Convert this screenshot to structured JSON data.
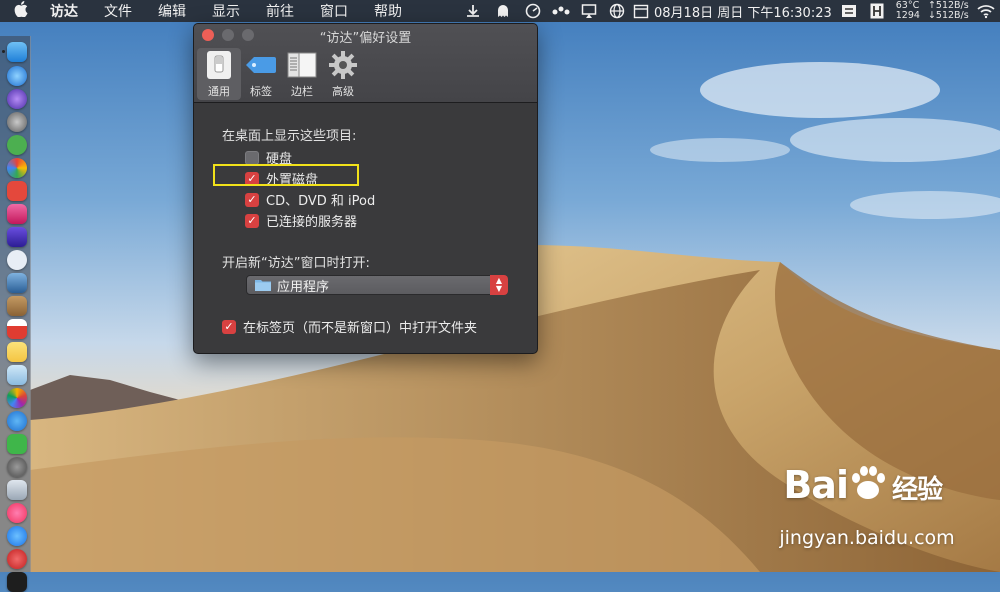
{
  "menubar": {
    "apple_icon": "apple-logo",
    "items": [
      "访达",
      "文件",
      "编辑",
      "显示",
      "前往",
      "窗口",
      "帮助"
    ],
    "clock": "08月18日 周日 下午16:30:23",
    "temperature": "63°C",
    "fan_rpm": "1294",
    "net_up": "↑512B/s",
    "net_down": "↓512B/s"
  },
  "window": {
    "title": "“访达”偏好设置",
    "toolbar": [
      {
        "label": "通用",
        "icon": "switch-icon",
        "active": true
      },
      {
        "label": "标签",
        "icon": "tag-icon",
        "active": false
      },
      {
        "label": "边栏",
        "icon": "sidebar-icon",
        "active": false
      },
      {
        "label": "高级",
        "icon": "gear-icon",
        "active": false
      }
    ],
    "desktop_section_label": "在桌面上显示这些项目:",
    "checkboxes": [
      {
        "label": "硬盘",
        "checked": false
      },
      {
        "label": "外置磁盘",
        "checked": true
      },
      {
        "label": "CD、DVD 和 iPod",
        "checked": true
      },
      {
        "label": "已连接的服务器",
        "checked": true
      }
    ],
    "new_window_label": "开启新“访达”窗口时打开:",
    "new_window_value": "应用程序",
    "open_in_tabs_label": "在标签页（而不是新窗口）中打开文件夹",
    "open_in_tabs_checked": true
  },
  "watermark": {
    "brand": "Bai 经验",
    "url": "jingyan.baidu.com"
  },
  "colors": {
    "accent_checkbox": "#d84141",
    "highlight_box": "#f2e21a",
    "window_bg": "#3a3a3c"
  }
}
